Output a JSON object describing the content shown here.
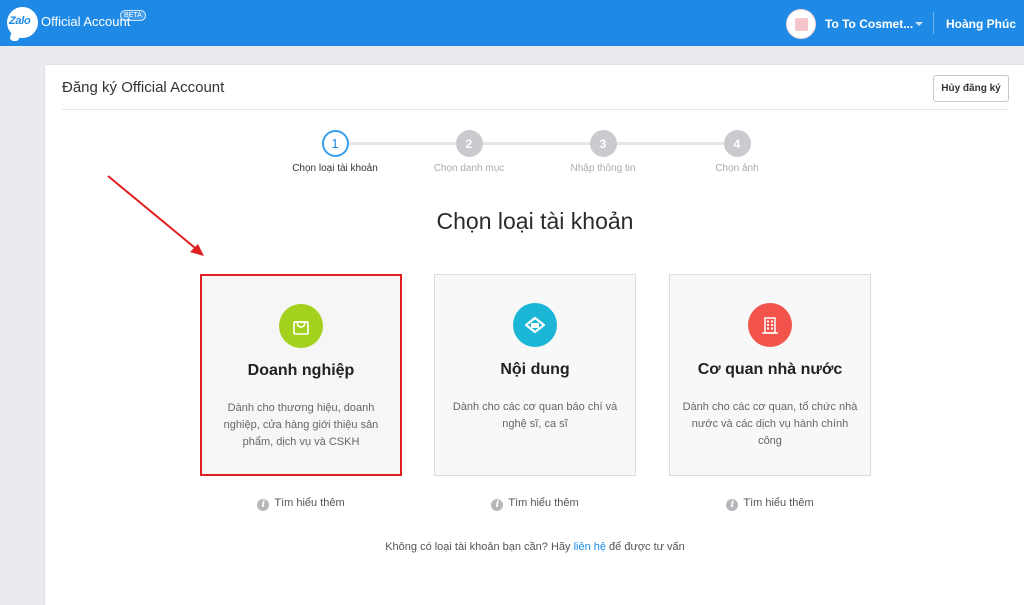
{
  "header": {
    "logo_text": "Zalo",
    "app_title": "Official Account",
    "beta_label": "BETA",
    "account_name": "To To Cosmet...",
    "user_name": "Hoàng Phúc",
    "brand_color": "#1f8ae6"
  },
  "page": {
    "title": "Đăng ký Official Account",
    "cancel_label": "Hủy đăng ký"
  },
  "stepper": {
    "steps": [
      {
        "number": "1",
        "label": "Chọn loại tài khoản",
        "state": "active"
      },
      {
        "number": "2",
        "label": "Chọn danh mục",
        "state": "inactive"
      },
      {
        "number": "3",
        "label": "Nhập thông tin",
        "state": "inactive"
      },
      {
        "number": "4",
        "label": "Chọn ảnh",
        "state": "inactive"
      }
    ]
  },
  "main": {
    "section_title": "Chọn loại tài khoản",
    "options": [
      {
        "title": "Doanh nghiệp",
        "description": "Dành cho thương hiệu, doanh nghiệp, cửa hàng giới thiệu sản phẩm, dịch vụ và CSKH",
        "icon": "shopping-bag-icon",
        "color": "#a4d11e",
        "selected": true
      },
      {
        "title": "Nội dung",
        "description": "Dành cho các cơ quan báo chí và nghệ sĩ, ca sĩ",
        "icon": "content-icon",
        "color": "#1bb5d6",
        "selected": false
      },
      {
        "title": "Cơ quan nhà nước",
        "description": "Dành cho các cơ quan, tổ chức nhà nước và các dịch vụ hành chính công",
        "icon": "building-icon",
        "color": "#f2534a",
        "selected": false
      }
    ],
    "learn_more_label": "Tìm hiểu thêm",
    "footer_prefix": "Không có loại tài khoản bạn cần? Hãy ",
    "footer_link": "liên hệ",
    "footer_suffix": " để được tư vấn"
  },
  "annotation": {
    "color": "#e02020"
  }
}
